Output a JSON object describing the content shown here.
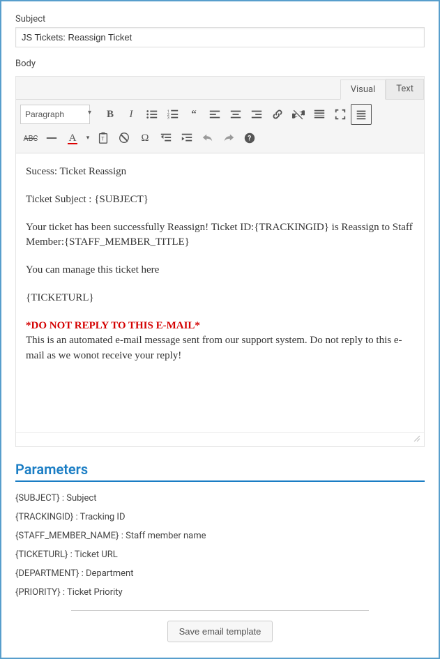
{
  "subject": {
    "label": "Subject",
    "value": "JS Tickets: Reassign Ticket"
  },
  "body": {
    "label": "Body",
    "tabs": {
      "visual": "Visual",
      "text": "Text"
    },
    "format_select": "Paragraph",
    "content": {
      "p1": "Sucess: Ticket Reassign",
      "p2": "Ticket Subject : {SUBJECT}",
      "p3": "Your ticket has been successfully Reassign! Ticket ID:{TRACKINGID} is Reassign to Staff Member:{STAFF_MEMBER_TITLE}",
      "p4": "You can manage this ticket here",
      "p5": "{TICKETURL}",
      "warn": "*DO NOT REPLY TO THIS E-MAIL*",
      "p6": "This is an automated e-mail message sent from our support system. Do not reply to this e-mail as we wonot receive your reply!"
    }
  },
  "parameters": {
    "heading": "Parameters",
    "items": [
      "{SUBJECT} : Subject",
      "{TRACKINGID} : Tracking ID",
      "{STAFF_MEMBER_NAME} : Staff member name",
      "{TICKETURL} : Ticket URL",
      "{DEPARTMENT} : Department",
      "{PRIORITY} : Ticket Priority"
    ]
  },
  "actions": {
    "save": "Save email template"
  }
}
